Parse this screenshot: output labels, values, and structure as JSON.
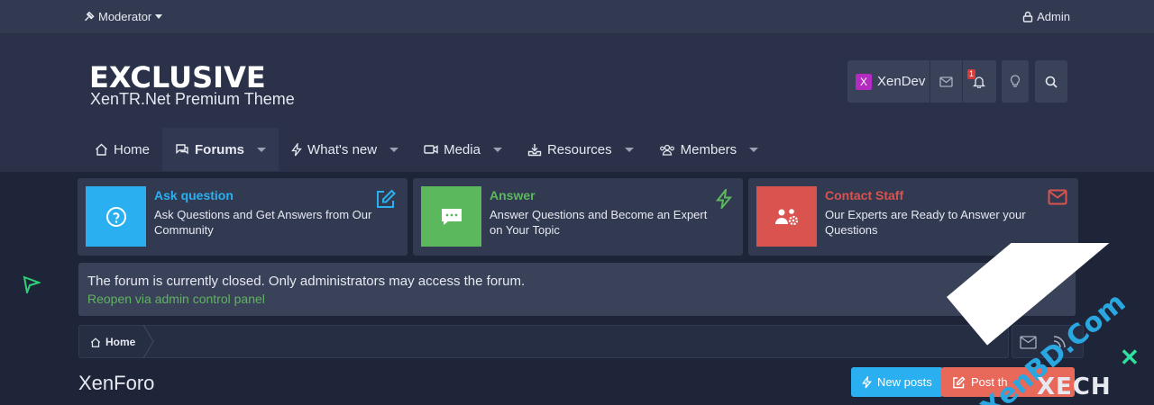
{
  "topbar": {
    "moderator": "Moderator",
    "admin": "Admin"
  },
  "header": {
    "logo": "EXCLUSIVE",
    "tagline": "XenTR.Net Premium Theme",
    "user": {
      "avatar_letter": "X",
      "name": "XenDev",
      "alerts_count": "1"
    }
  },
  "nav": {
    "home": "Home",
    "forums": "Forums",
    "whats_new": "What's new",
    "media": "Media",
    "resources": "Resources",
    "members": "Members"
  },
  "cards": [
    {
      "title": "Ask question",
      "desc": "Ask Questions and Get Answers from Our Community",
      "color": "#2ab0f0"
    },
    {
      "title": "Answer",
      "desc": "Answer Questions and Become an Expert on Your Topic",
      "color": "#5cb85c"
    },
    {
      "title": "Contact Staff",
      "desc": "Our Experts are Ready to Answer your Questions",
      "color": "#d9534f"
    }
  ],
  "notice": {
    "message": "The forum is currently closed. Only administrators may access the forum.",
    "link": "Reopen via admin control panel"
  },
  "breadcrumb": {
    "home": "Home"
  },
  "page": {
    "title": "XenForo",
    "new_posts": "New posts",
    "post_thread": "Post th"
  },
  "watermark": {
    "site": "XenBD.Com",
    "brand": "XECH",
    "mark": "✕"
  }
}
